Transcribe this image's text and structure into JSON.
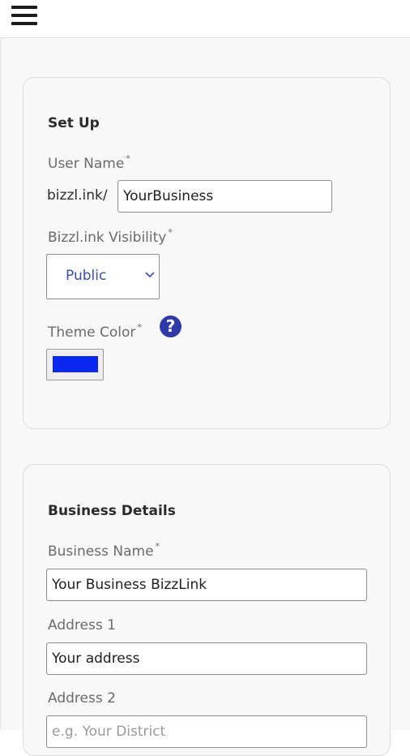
{
  "header": {
    "menu_icon": "hamburger-menu-icon"
  },
  "setup": {
    "title": "Set Up",
    "username_label": "User Name",
    "required_mark": "*",
    "username_prefix": "bizzl.ink/",
    "username_value": "YourBusiness",
    "visibility_label": "Bizzl.ink Visibility",
    "visibility_value": "Public",
    "theme_color_label": "Theme Color",
    "theme_color_value": "#0a28f0",
    "help_icon_text": "?"
  },
  "business": {
    "title": "Business Details",
    "business_name_label": "Business Name",
    "business_name_value": "Your Business BizzLink",
    "address1_label": "Address 1",
    "address1_value": "Your address",
    "address2_label": "Address 2",
    "address2_placeholder": "e.g. Your District"
  },
  "colors": {
    "accent": "#2f3aa8",
    "select_text": "#3a4fa8",
    "page_background": "#f7f8f7"
  }
}
